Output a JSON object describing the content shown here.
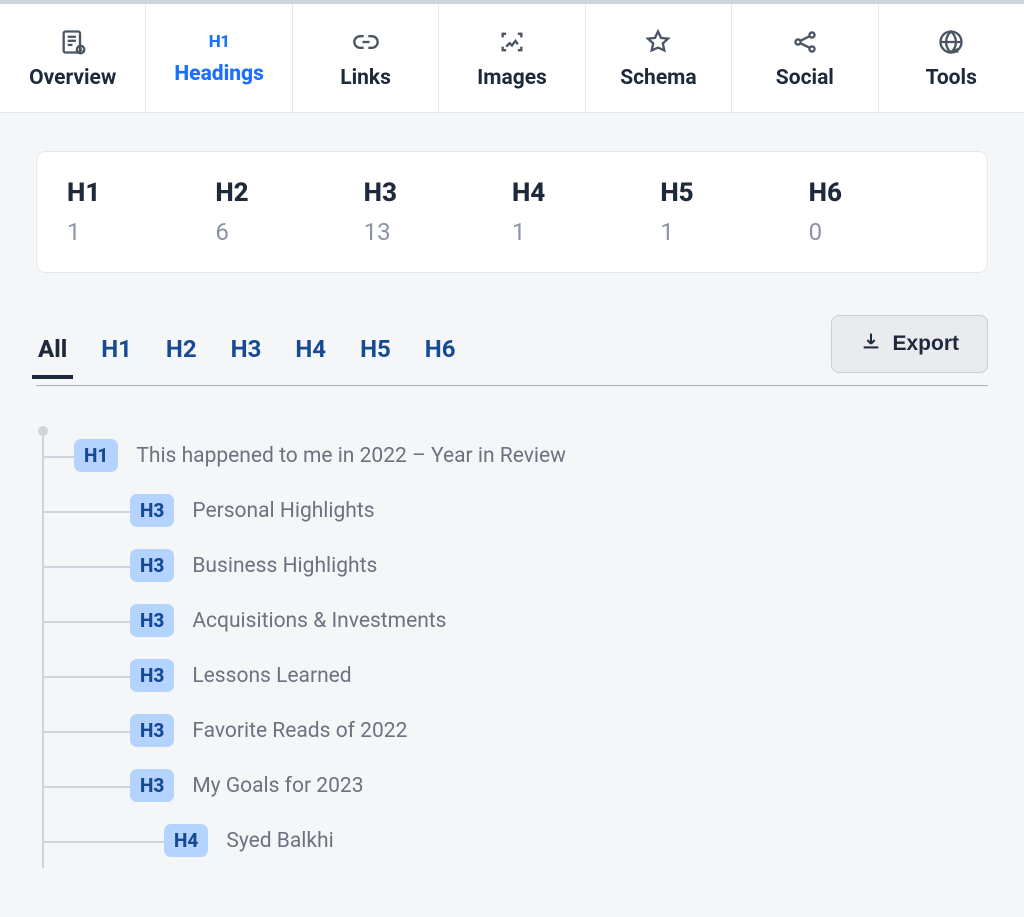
{
  "tabs": {
    "overview": {
      "label": "Overview"
    },
    "headings": {
      "label": "Headings",
      "icon_text": "H1"
    },
    "links": {
      "label": "Links"
    },
    "images": {
      "label": "Images"
    },
    "schema": {
      "label": "Schema"
    },
    "social": {
      "label": "Social"
    },
    "tools": {
      "label": "Tools"
    }
  },
  "summary": {
    "h1": {
      "label": "H1",
      "value": "1"
    },
    "h2": {
      "label": "H2",
      "value": "6"
    },
    "h3": {
      "label": "H3",
      "value": "13"
    },
    "h4": {
      "label": "H4",
      "value": "1"
    },
    "h5": {
      "label": "H5",
      "value": "1"
    },
    "h6": {
      "label": "H6",
      "value": "0"
    }
  },
  "filter": {
    "all": "All",
    "h1": "H1",
    "h2": "H2",
    "h3": "H3",
    "h4": "H4",
    "h5": "H5",
    "h6": "H6",
    "export": "Export"
  },
  "tree": [
    {
      "level": 1,
      "badge": "H1",
      "text": "This happened to me in 2022 – Year in Review"
    },
    {
      "level": 2,
      "badge": "H3",
      "text": "Personal Highlights"
    },
    {
      "level": 2,
      "badge": "H3",
      "text": "Business Highlights"
    },
    {
      "level": 2,
      "badge": "H3",
      "text": "Acquisitions & Investments"
    },
    {
      "level": 2,
      "badge": "H3",
      "text": "Lessons Learned"
    },
    {
      "level": 2,
      "badge": "H3",
      "text": "Favorite Reads of 2022"
    },
    {
      "level": 2,
      "badge": "H3",
      "text": "My Goals for 2023"
    },
    {
      "level": 3,
      "badge": "H4",
      "text": "Syed Balkhi"
    }
  ]
}
